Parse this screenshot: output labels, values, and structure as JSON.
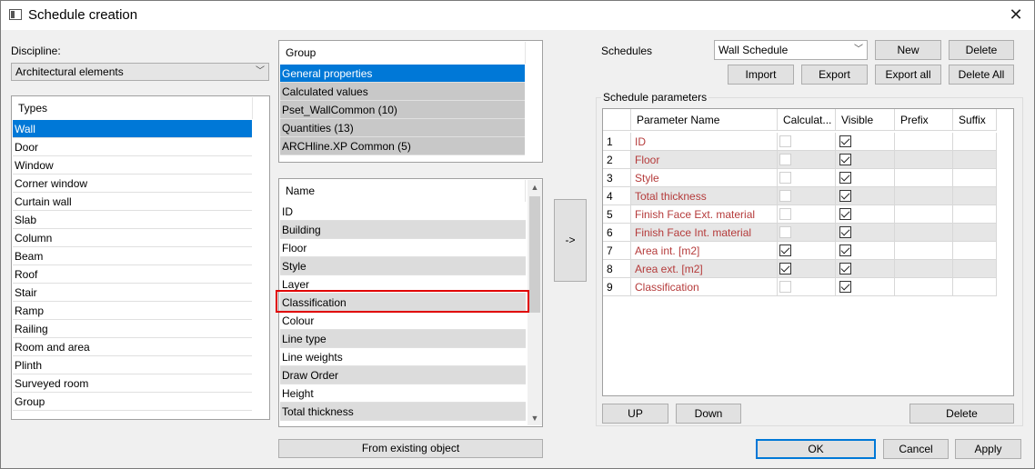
{
  "window": {
    "title": "Schedule creation"
  },
  "discipline": {
    "label": "Discipline:",
    "value": "Architectural elements"
  },
  "types": {
    "header": "Types",
    "items": [
      "Wall",
      "Door",
      "Window",
      "Corner window",
      "Curtain wall",
      "Slab",
      "Column",
      "Beam",
      "Roof",
      "Stair",
      "Ramp",
      "Railing",
      "Room and area",
      "Plinth",
      "Surveyed room",
      "Group"
    ],
    "selected_index": 0
  },
  "groups": {
    "header": "Group",
    "items": [
      "General properties",
      "Calculated values",
      "Pset_WallCommon (10)",
      "Quantities (13)",
      "ARCHline.XP Common (5)"
    ],
    "selected_index": 0
  },
  "names": {
    "header": "Name",
    "items": [
      "ID",
      "Building",
      "Floor",
      "Style",
      "Layer",
      "Classification",
      "Colour",
      "Line type",
      "Line weights",
      "Draw Order",
      "Height",
      "Total thickness"
    ],
    "highlighted_index": 5
  },
  "add_button": "->",
  "from_existing_button": "From existing object",
  "schedules": {
    "label": "Schedules",
    "value": "Wall Schedule",
    "new_button": "New",
    "delete_button": "Delete",
    "import_button": "Import",
    "export_button": "Export",
    "export_all_button": "Export all",
    "delete_all_button": "Delete All"
  },
  "params": {
    "title": "Schedule parameters",
    "columns": [
      "Parameter Name",
      "Calculat...",
      "Visible",
      "Prefix",
      "Suffix"
    ],
    "rows": [
      {
        "num": "1",
        "name": "ID",
        "calc": false,
        "calc_enabled": false,
        "visible": true
      },
      {
        "num": "2",
        "name": "Floor",
        "calc": false,
        "calc_enabled": false,
        "visible": true
      },
      {
        "num": "3",
        "name": "Style",
        "calc": false,
        "calc_enabled": false,
        "visible": true
      },
      {
        "num": "4",
        "name": "Total thickness",
        "calc": false,
        "calc_enabled": false,
        "visible": true
      },
      {
        "num": "5",
        "name": "Finish Face Ext. material",
        "calc": false,
        "calc_enabled": false,
        "visible": true
      },
      {
        "num": "6",
        "name": "Finish Face Int. material",
        "calc": false,
        "calc_enabled": false,
        "visible": true
      },
      {
        "num": "7",
        "name": "Area int. [m2]",
        "calc": true,
        "calc_enabled": true,
        "visible": true
      },
      {
        "num": "8",
        "name": "Area ext. [m2]",
        "calc": true,
        "calc_enabled": true,
        "visible": true
      },
      {
        "num": "9",
        "name": "Classification",
        "calc": false,
        "calc_enabled": false,
        "visible": true
      }
    ],
    "up_button": "UP",
    "down_button": "Down",
    "delete_button": "Delete"
  },
  "footer": {
    "ok": "OK",
    "cancel": "Cancel",
    "apply": "Apply"
  },
  "colors": {
    "selection": "#0078d7",
    "param_name": "#b53b3b",
    "highlight": "#e00000"
  }
}
